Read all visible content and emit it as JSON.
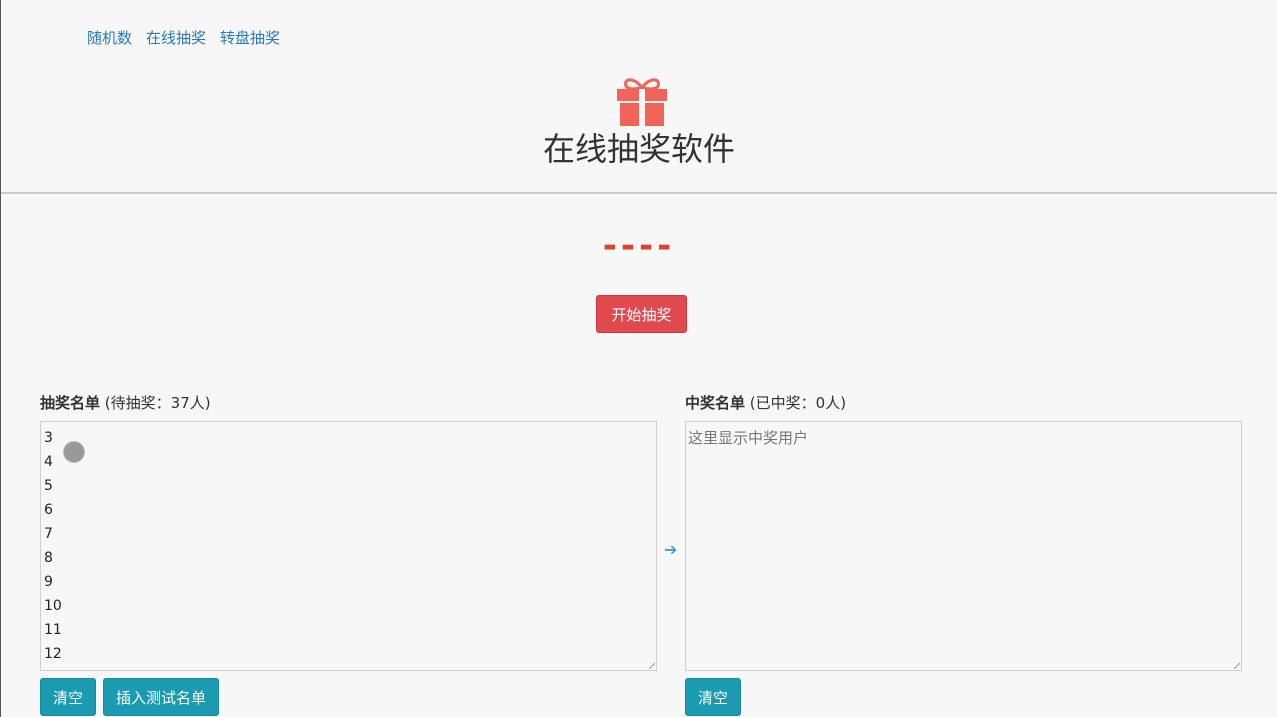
{
  "nav": {
    "items": [
      "随机数",
      "在线抽奖",
      "转盘抽奖"
    ]
  },
  "header": {
    "icon": "gift-icon",
    "title": "在线抽奖软件"
  },
  "draw": {
    "result": "----",
    "start_label": "开始抽奖"
  },
  "pool": {
    "title": "抽奖名单",
    "count_text": "(待抽奖：37人)",
    "entries": [
      "3",
      "4",
      "5",
      "6",
      "7",
      "8",
      "9",
      "10",
      "11",
      "12"
    ],
    "clear_label": "清空",
    "insert_label": "插入测试名单"
  },
  "winners": {
    "title": "中奖名单",
    "count_text": "(已中奖：0人)",
    "placeholder": "这里显示中奖用户",
    "clear_label": "清空"
  },
  "colors": {
    "accent": "#1a9bb2",
    "start_button": "#e04a4f",
    "link": "#2a7ab8",
    "result": "#e0412f",
    "gift": "#f26457"
  }
}
